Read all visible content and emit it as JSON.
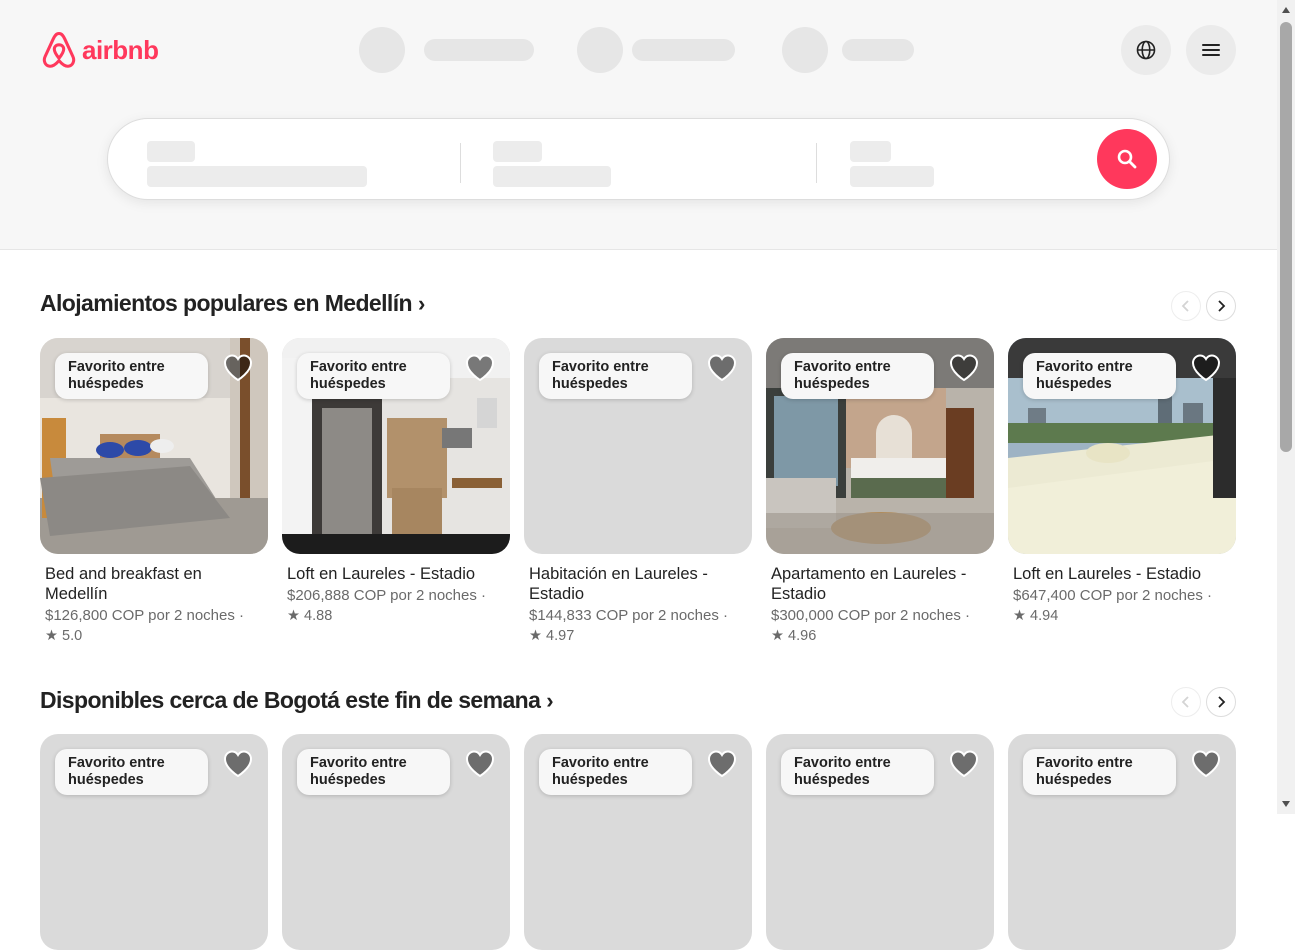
{
  "brand": {
    "name": "airbnb",
    "color": "#ff385c"
  },
  "icons": {
    "globe": "globe-icon",
    "menu": "hamburger-menu-icon",
    "search": "search-icon",
    "heart": "heart-icon",
    "star": "star-icon"
  },
  "sections": [
    {
      "title": "Alojamientos populares en Medellín",
      "chevron": "›",
      "cards": [
        {
          "badge": "Favorito entre huéspedes",
          "title": "Bed and breakfast en Medellín",
          "price": "$126,800 COP por 2 noches",
          "rating": "5.0"
        },
        {
          "badge": "Favorito entre huéspedes",
          "title": "Loft en Laureles - Estadio",
          "price": "$206,888 COP por 2 noches",
          "rating": "4.88"
        },
        {
          "badge": "Favorito entre huéspedes",
          "title": "Habitación en Laureles - Estadio",
          "price": "$144,833 COP por 2 noches",
          "rating": "4.97"
        },
        {
          "badge": "Favorito entre huéspedes",
          "title": "Apartamento en Laureles - Estadio",
          "price": "$300,000 COP por 2 noches",
          "rating": "4.96"
        },
        {
          "badge": "Favorito entre huéspedes",
          "title": "Loft en Laureles - Estadio",
          "price": "$647,400 COP por 2 noches",
          "rating": "4.94"
        }
      ]
    },
    {
      "title": "Disponibles cerca de Bogotá este fin de semana",
      "chevron": "›",
      "cards": [
        {
          "badge": "Favorito entre huéspedes"
        },
        {
          "badge": "Favorito entre huéspedes"
        },
        {
          "badge": "Favorito entre huéspedes"
        },
        {
          "badge": "Favorito entre huéspedes"
        },
        {
          "badge": "Favorito entre huéspedes"
        }
      ]
    }
  ],
  "rating_separator": " ·",
  "star_glyph": "★"
}
